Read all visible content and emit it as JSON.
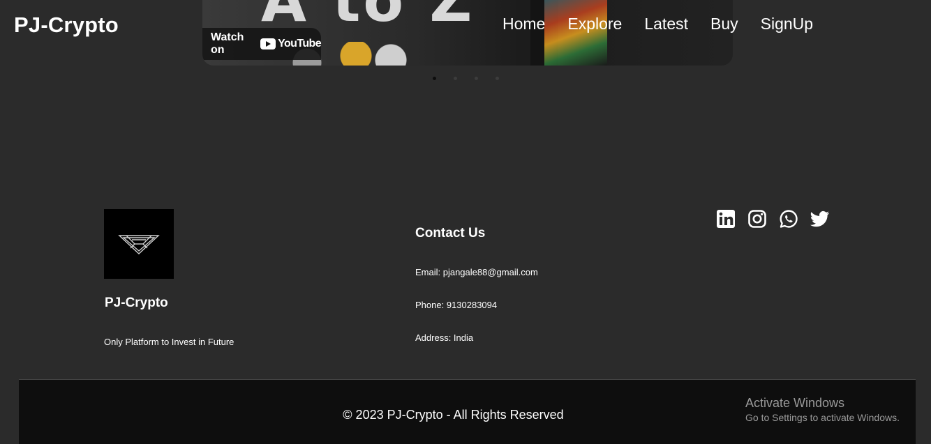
{
  "header": {
    "brand": "PJ-Crypto",
    "nav": [
      "Home",
      "Explore",
      "Latest",
      "Buy",
      "SignUp"
    ]
  },
  "video": {
    "title_text": "A to Z",
    "watch_on": "Watch on",
    "youtube": "YouTube"
  },
  "carousel": {
    "dot_count": 4,
    "active_index": 0
  },
  "footer": {
    "brand": "PJ-Crypto",
    "tagline": "Only Platform to Invest in Future",
    "contact": {
      "title": "Contact Us",
      "email": "Email: pjangale88@gmail.com",
      "phone": "Phone: 9130283094",
      "address": "Address: India"
    },
    "socials": [
      "linkedin-icon",
      "instagram-icon",
      "whatsapp-icon",
      "twitter-icon"
    ],
    "copyright": "© 2023 PJ-Crypto - All Rights Reserved"
  },
  "os_overlay": {
    "line1": "Activate Windows",
    "line2": "Go to Settings to activate Windows."
  },
  "colors": {
    "background": "#2b2b2b",
    "bottom_bar": "#0e0e0e",
    "text": "#ffffff"
  }
}
